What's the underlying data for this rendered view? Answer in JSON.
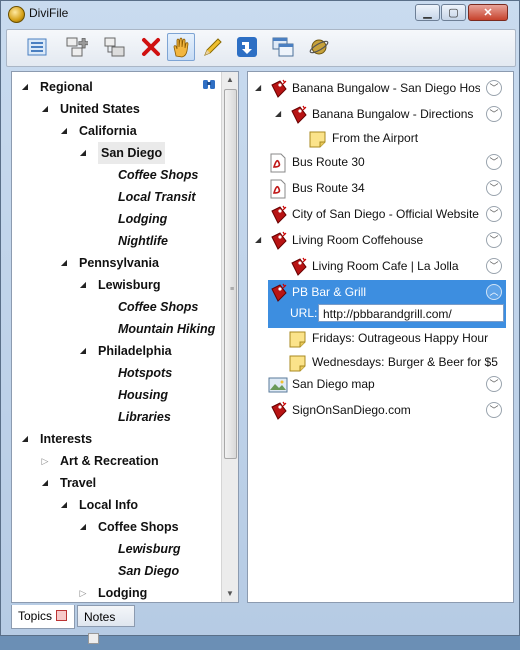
{
  "window": {
    "title": "DiviFile"
  },
  "toolbar": {
    "buttons": [
      {
        "name": "list-view",
        "icon": "list-icon"
      },
      {
        "name": "add-topic",
        "icon": "add-node-icon"
      },
      {
        "name": "add-subtopic",
        "icon": "add-child-icon"
      },
      {
        "name": "delete",
        "icon": "red-x-icon"
      },
      {
        "name": "pan",
        "icon": "hand-icon",
        "active": true
      },
      {
        "name": "edit",
        "icon": "pencil-icon"
      },
      {
        "name": "import",
        "icon": "blue-arrow-icon"
      },
      {
        "name": "windows",
        "icon": "windows-icon"
      },
      {
        "name": "web",
        "icon": "globe-icon"
      }
    ]
  },
  "tree": [
    {
      "label": "Regional",
      "level": 0,
      "state": "open",
      "leaf": false
    },
    {
      "label": "United States",
      "level": 1,
      "state": "open",
      "leaf": false
    },
    {
      "label": "California",
      "level": 2,
      "state": "open",
      "leaf": false
    },
    {
      "label": "San Diego",
      "level": 3,
      "state": "open",
      "leaf": false,
      "selected": true
    },
    {
      "label": "Coffee Shops",
      "level": 4,
      "state": "none",
      "leaf": true
    },
    {
      "label": "Local Transit",
      "level": 4,
      "state": "none",
      "leaf": true
    },
    {
      "label": "Lodging",
      "level": 4,
      "state": "none",
      "leaf": true
    },
    {
      "label": "Nightlife",
      "level": 4,
      "state": "none",
      "leaf": true
    },
    {
      "label": "Pennsylvania",
      "level": 2,
      "state": "open",
      "leaf": false
    },
    {
      "label": "Lewisburg",
      "level": 3,
      "state": "open",
      "leaf": false
    },
    {
      "label": "Coffee Shops",
      "level": 4,
      "state": "none",
      "leaf": true
    },
    {
      "label": "Mountain Hiking",
      "level": 4,
      "state": "none",
      "leaf": true
    },
    {
      "label": "Philadelphia",
      "level": 3,
      "state": "open",
      "leaf": false
    },
    {
      "label": "Hotspots",
      "level": 4,
      "state": "none",
      "leaf": true
    },
    {
      "label": "Housing",
      "level": 4,
      "state": "none",
      "leaf": true
    },
    {
      "label": "Libraries",
      "level": 4,
      "state": "none",
      "leaf": true
    },
    {
      "label": "Interests",
      "level": 0,
      "state": "open",
      "leaf": false
    },
    {
      "label": "Art & Recreation",
      "level": 1,
      "state": "closed",
      "leaf": false
    },
    {
      "label": "Travel",
      "level": 1,
      "state": "open",
      "leaf": false
    },
    {
      "label": "Local Info",
      "level": 2,
      "state": "open",
      "leaf": false
    },
    {
      "label": "Coffee Shops",
      "level": 3,
      "state": "open",
      "leaf": false
    },
    {
      "label": "Lewisburg",
      "level": 4,
      "state": "none",
      "leaf": true
    },
    {
      "label": "San Diego",
      "level": 4,
      "state": "none",
      "leaf": true
    },
    {
      "label": "Lodging",
      "level": 3,
      "state": "closed",
      "leaf": false
    }
  ],
  "items": [
    {
      "label": "Banana Bungalow - San Diego Hos",
      "icon": "bookmark",
      "indent": 0,
      "expander": "open",
      "chev": "down"
    },
    {
      "label": "Banana Bungalow - Directions",
      "icon": "bookmark",
      "indent": 1,
      "expander": "open",
      "chev": "down"
    },
    {
      "label": "From the Airport",
      "icon": "note",
      "indent": 2,
      "expander": "none",
      "chev": "none"
    },
    {
      "label": "Bus Route 30",
      "icon": "pdf",
      "indent": 0,
      "expander": "none",
      "chev": "down"
    },
    {
      "label": "Bus Route 34",
      "icon": "pdf",
      "indent": 0,
      "expander": "none",
      "chev": "down"
    },
    {
      "label": "City of San Diego - Official Website",
      "icon": "bookmark",
      "indent": 0,
      "expander": "none",
      "chev": "down"
    },
    {
      "label": "Living Room Coffehouse",
      "icon": "bookmark",
      "indent": 0,
      "expander": "open",
      "chev": "down"
    },
    {
      "label": "Living Room Cafe | La Jolla",
      "icon": "bookmark",
      "indent": 1,
      "expander": "none",
      "chev": "down"
    },
    {
      "label": "PB Bar & Grill",
      "icon": "bookmark",
      "indent": 0,
      "expander": "open",
      "chev": "up",
      "selected": true
    },
    {
      "label": "Fridays: Outrageous Happy Hour",
      "icon": "note",
      "indent": 1,
      "expander": "none",
      "chev": "none"
    },
    {
      "label": "Wednesdays: Burger & Beer for $5",
      "icon": "note",
      "indent": 1,
      "expander": "none",
      "chev": "none"
    },
    {
      "label": "San Diego map",
      "icon": "image",
      "indent": 0,
      "expander": "none",
      "chev": "down"
    },
    {
      "label": "SignOnSanDiego.com",
      "icon": "bookmark",
      "indent": 0,
      "expander": "none",
      "chev": "down"
    }
  ],
  "selected_detail": {
    "url_label": "URL:",
    "url_value": "http://pbbarandgrill.com/"
  },
  "tabs": [
    {
      "label": "Topics",
      "active": true
    },
    {
      "label": "Notes",
      "active": false
    }
  ],
  "colors": {
    "selection": "#3d8ee0",
    "window_frame": "#c9dbef"
  }
}
